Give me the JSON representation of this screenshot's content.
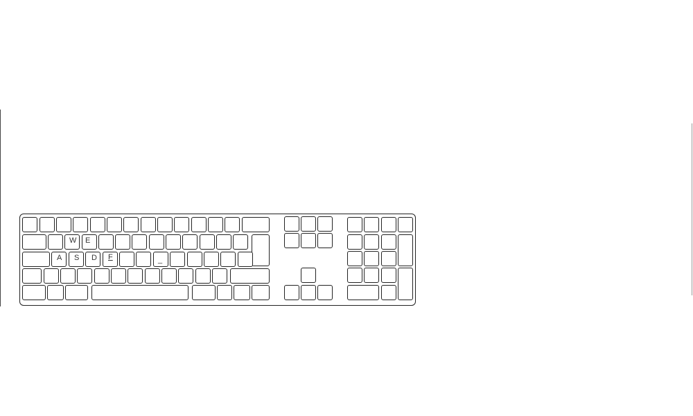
{
  "colors": {
    "outline": "#222222",
    "key_fill": "#ffffff",
    "background": "#ffffff"
  },
  "keys": {
    "w": "W",
    "e": "E",
    "a": "A",
    "s": "S",
    "d": "D",
    "f": "F",
    "underscore": "_"
  }
}
